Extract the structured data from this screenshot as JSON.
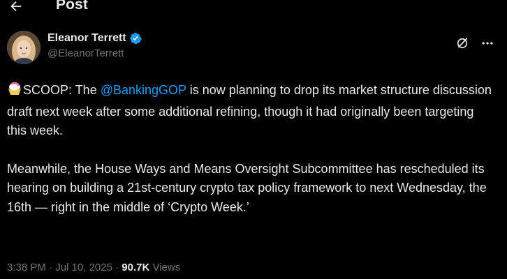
{
  "header": {
    "title": "Post"
  },
  "author": {
    "display_name": "Eleanor Terrett",
    "handle": "@EleanorTerrett",
    "verified": true,
    "verified_color": "#1d9bf0"
  },
  "post": {
    "emoji": "shaved-ice-icon",
    "p1_before": "SCOOP: The ",
    "p1_mention": "@BankingGOP",
    "p1_after": " is now planning to drop its market structure discussion draft next week after some additional refining, though it had originally been targeting this week.",
    "p2": "Meanwhile, the House Ways and Means Oversight Subcommittee has rescheduled its hearing on building a 21st-century crypto tax policy framework to next Wednesday, the 16th — right in the middle of ‘Crypto Week.’"
  },
  "meta": {
    "time": "3:38 PM",
    "separator": " · ",
    "date": "Jul 10, 2025",
    "views_count": "90.7K",
    "views_label": " Views"
  },
  "colors": {
    "background": "#000000",
    "text": "#e7e9ea",
    "secondary": "#71767b",
    "accent": "#1d9bf0"
  }
}
